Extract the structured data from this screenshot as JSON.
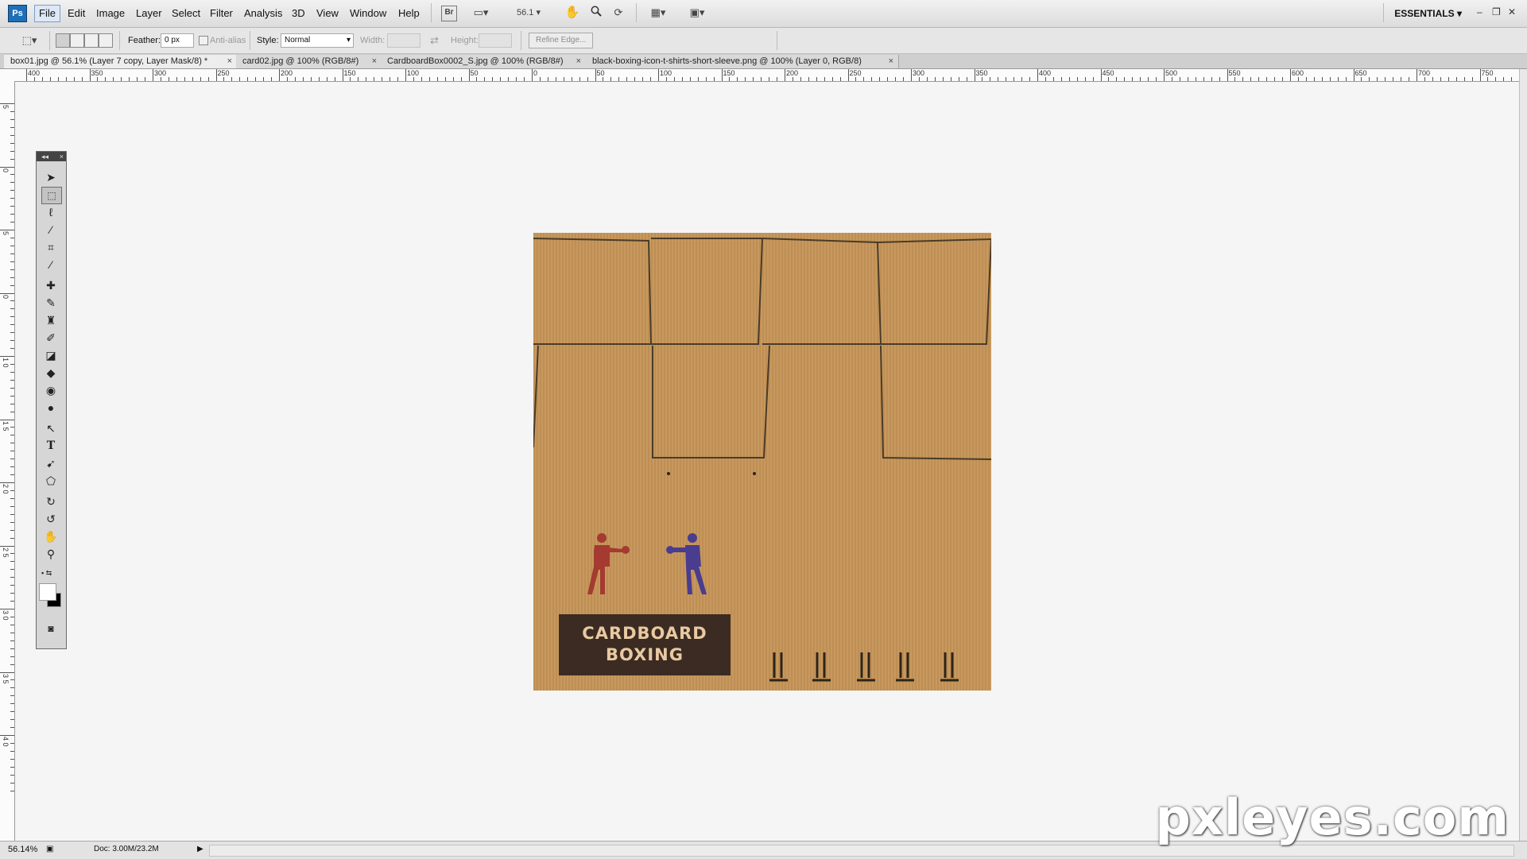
{
  "app": {
    "logo": "Ps"
  },
  "menubar": {
    "items": [
      "File",
      "Edit",
      "Image",
      "Layer",
      "Select",
      "Filter",
      "Analysis",
      "3D",
      "View",
      "Window",
      "Help"
    ],
    "bridge_label": "Br",
    "zoom_value": "56.1",
    "workspace": "ESSENTIALS"
  },
  "options": {
    "feather_label": "Feather:",
    "feather_value": "0 px",
    "antialias_label": "Anti-alias",
    "style_label": "Style:",
    "style_value": "Normal",
    "width_label": "Width:",
    "height_label": "Height:",
    "refine_edge": "Refine Edge..."
  },
  "tabs": [
    {
      "label": "box01.jpg @ 56.1% (Layer 7 copy, Layer Mask/8) *",
      "active": true
    },
    {
      "label": "card02.jpg @ 100% (RGB/8#)",
      "active": false
    },
    {
      "label": "CardboardBox0002_S.jpg @ 100% (RGB/8#)",
      "active": false
    },
    {
      "label": "black-boxing-icon-t-shirts-short-sleeve.png @ 100% (Layer 0, RGB/8)",
      "active": false
    }
  ],
  "ruler_top_labels": [
    "400",
    "350",
    "300",
    "250",
    "200",
    "150",
    "100",
    "50",
    "0",
    "50",
    "100",
    "150",
    "200",
    "250",
    "300",
    "350",
    "400",
    "450",
    "500",
    "550",
    "600",
    "650",
    "700",
    "750"
  ],
  "ruler_left_labels": [
    "5",
    "0",
    "5",
    "0",
    "1 0",
    "1 5",
    "2 0",
    "2 5",
    "3 0",
    "3 5",
    "4 0"
  ],
  "canvas": {
    "title_line1": "CARDBOARD",
    "title_line2": "BOXING",
    "fighter_red_color": "#a43a30",
    "fighter_blue_color": "#4a3c8e",
    "cardboard_color": "#c4955a"
  },
  "tools": [
    "move-tool",
    "marquee-tool",
    "lasso-tool",
    "magic-wand-tool",
    "crop-tool",
    "eyedropper-tool",
    "healing-tool",
    "brush-tool",
    "clone-stamp-tool",
    "history-brush-tool",
    "eraser-tool",
    "paint-bucket-tool",
    "blur-tool",
    "dodge-tool",
    "path-selection-tool",
    "type-tool",
    "pen-tool",
    "custom-shape-tool",
    "3d-rotate-tool",
    "3d-orbit-tool",
    "hand-tool",
    "zoom-tool"
  ],
  "status": {
    "zoom": "56.14%",
    "doc": "Doc: 3.00M/23.2M"
  },
  "watermark": "pxleyes.com"
}
